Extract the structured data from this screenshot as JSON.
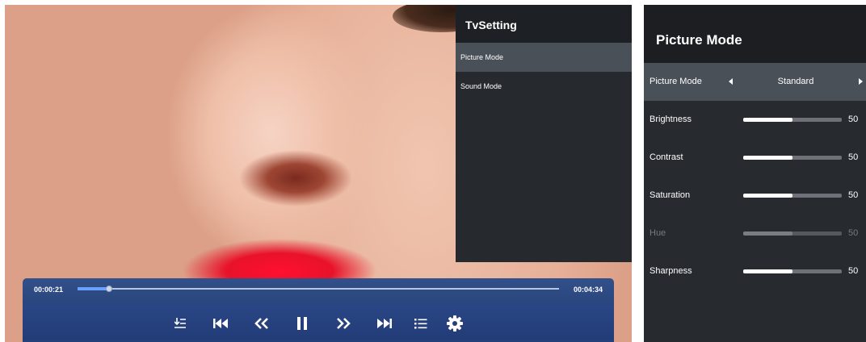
{
  "tv_setting": {
    "title": "TvSetting",
    "items": [
      {
        "label": "Picture Mode",
        "active": true
      },
      {
        "label": "Sound Mode",
        "active": false
      }
    ]
  },
  "player": {
    "current_time": "00:00:21",
    "total_time": "00:04:34",
    "progress_fraction": 0.066,
    "controls": [
      {
        "name": "chapters-icon"
      },
      {
        "name": "skip-previous-icon"
      },
      {
        "name": "rewind-icon"
      },
      {
        "name": "pause-icon"
      },
      {
        "name": "fast-forward-icon"
      },
      {
        "name": "skip-next-icon"
      },
      {
        "name": "playlist-icon"
      },
      {
        "name": "gear-icon"
      }
    ],
    "colors": {
      "bar": "#2b4780",
      "progress": "#6aa0ff"
    }
  },
  "picture_mode": {
    "title": "Picture Mode",
    "mode": {
      "label": "Picture Mode",
      "value": "Standard"
    },
    "settings": [
      {
        "label": "Brightness",
        "value": "50",
        "level": 0.5,
        "enabled": true
      },
      {
        "label": "Contrast",
        "value": "50",
        "level": 0.5,
        "enabled": true
      },
      {
        "label": "Saturation",
        "value": "50",
        "level": 0.5,
        "enabled": true
      },
      {
        "label": "Hue",
        "value": "50",
        "level": 0.5,
        "enabled": false
      },
      {
        "label": "Sharpness",
        "value": "50",
        "level": 0.5,
        "enabled": true
      }
    ]
  }
}
